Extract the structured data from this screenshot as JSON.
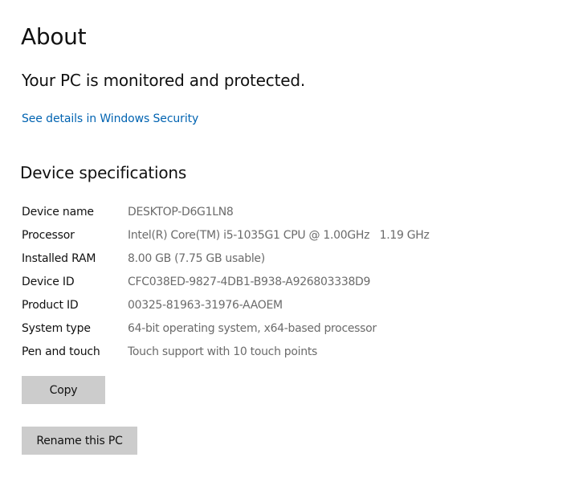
{
  "page": {
    "title": "About"
  },
  "security": {
    "status_text": "Your PC is monitored and protected.",
    "link_label": "See details in Windows Security",
    "link_color": "#0063b1"
  },
  "device_specs": {
    "section_title": "Device specifications",
    "rows": [
      {
        "label": "Device name",
        "value": "DESKTOP-D6G1LN8"
      },
      {
        "label": "Processor",
        "value": "Intel(R) Core(TM) i5-1035G1 CPU @ 1.00GHz   1.19 GHz"
      },
      {
        "label": "Installed RAM",
        "value": "8.00 GB (7.75 GB usable)"
      },
      {
        "label": "Device ID",
        "value": "CFC038ED-9827-4DB1-B938-A926803338D9"
      },
      {
        "label": "Product ID",
        "value": "00325-81963-31976-AAOEM"
      },
      {
        "label": "System type",
        "value": "64-bit operating system, x64-based processor"
      },
      {
        "label": "Pen and touch",
        "value": "Touch support with 10 touch points"
      }
    ]
  },
  "buttons": {
    "copy_label": "Copy",
    "rename_label": "Rename this PC",
    "button_color": "#cccccc"
  }
}
